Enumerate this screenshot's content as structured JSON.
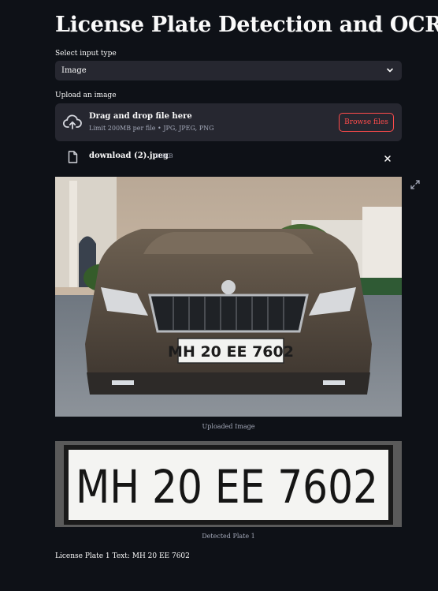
{
  "page": {
    "title": "License Plate Detection and OCR"
  },
  "input_type": {
    "label": "Select input type",
    "selected": "Image"
  },
  "uploader": {
    "label": "Upload an image",
    "drop_title": "Drag and drop file here",
    "drop_limit": "Limit 200MB per file • JPG, JPEG, PNG",
    "browse_label": "Browse files",
    "file_name": "download (2).jpeg",
    "file_size": "9.6KB"
  },
  "uploaded": {
    "caption": "Uploaded Image",
    "plate_text": "MH 20 EE 7602"
  },
  "detected": {
    "caption": "Detected Plate 1",
    "plate_text": "MH 20 EE 7602"
  },
  "result": {
    "text": "License Plate 1 Text: MH 20 EE 7602"
  },
  "icons": [
    "chevron-down-icon",
    "cloud-upload-icon",
    "file-icon",
    "close-icon",
    "fullscreen-icon"
  ],
  "colors": {
    "background": "#0e1117",
    "widget": "#262730",
    "accent": "#ff4b4b",
    "muted": "#a3a8b8"
  }
}
